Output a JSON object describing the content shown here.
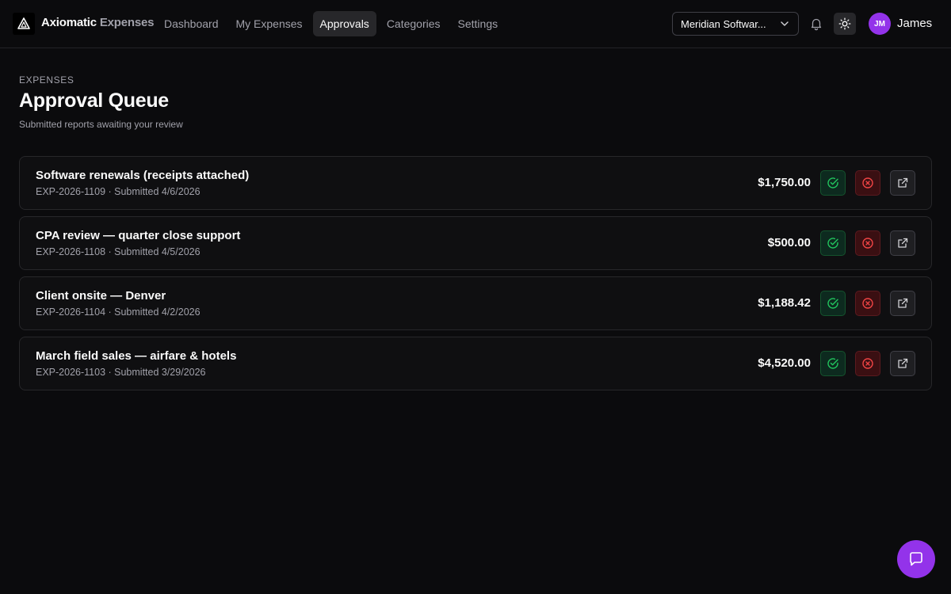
{
  "app": {
    "brand_primary": "Axiomatic",
    "brand_secondary": "Expenses",
    "logo_icon": "triangle-logo-icon"
  },
  "nav": {
    "items": [
      {
        "label": "Dashboard",
        "active": false
      },
      {
        "label": "My Expenses",
        "active": false
      },
      {
        "label": "Approvals",
        "active": true
      },
      {
        "label": "Categories",
        "active": false
      },
      {
        "label": "Settings",
        "active": false
      }
    ]
  },
  "header": {
    "workspace": "Meridian Software Co.",
    "workspace_display": "Meridian Softwar...",
    "bell_icon": "bell-icon",
    "theme_icon": "sun-icon",
    "avatar_initials": "JM",
    "username": "James"
  },
  "page": {
    "eyebrow": "EXPENSES",
    "title": "Approval Queue",
    "subtitle": "Submitted reports awaiting your review"
  },
  "reports": [
    {
      "title": "Software renewals (receipts attached)",
      "id": "EXP-2026-1109",
      "submitted": "4/6/2026",
      "meta": "EXP-2026-1109 · Submitted 4/6/2026",
      "amount": "$1,750.00"
    },
    {
      "title": "CPA review — quarter close support",
      "id": "EXP-2026-1108",
      "submitted": "4/5/2026",
      "meta": "EXP-2026-1108 · Submitted 4/5/2026",
      "amount": "$500.00"
    },
    {
      "title": "Client onsite — Denver",
      "id": "EXP-2026-1104",
      "submitted": "4/2/2026",
      "meta": "EXP-2026-1104 · Submitted 4/2/2026",
      "amount": "$1,188.42"
    },
    {
      "title": "March field sales — airfare & hotels",
      "id": "EXP-2026-1103",
      "submitted": "3/29/2026",
      "meta": "EXP-2026-1103 · Submitted 3/29/2026",
      "amount": "$4,520.00"
    }
  ],
  "colors": {
    "background": "#0b0b0d",
    "accent": "#9333ea",
    "approve": "#22c55e",
    "reject": "#ef4444"
  },
  "chat_icon": "chat-bubble-icon"
}
